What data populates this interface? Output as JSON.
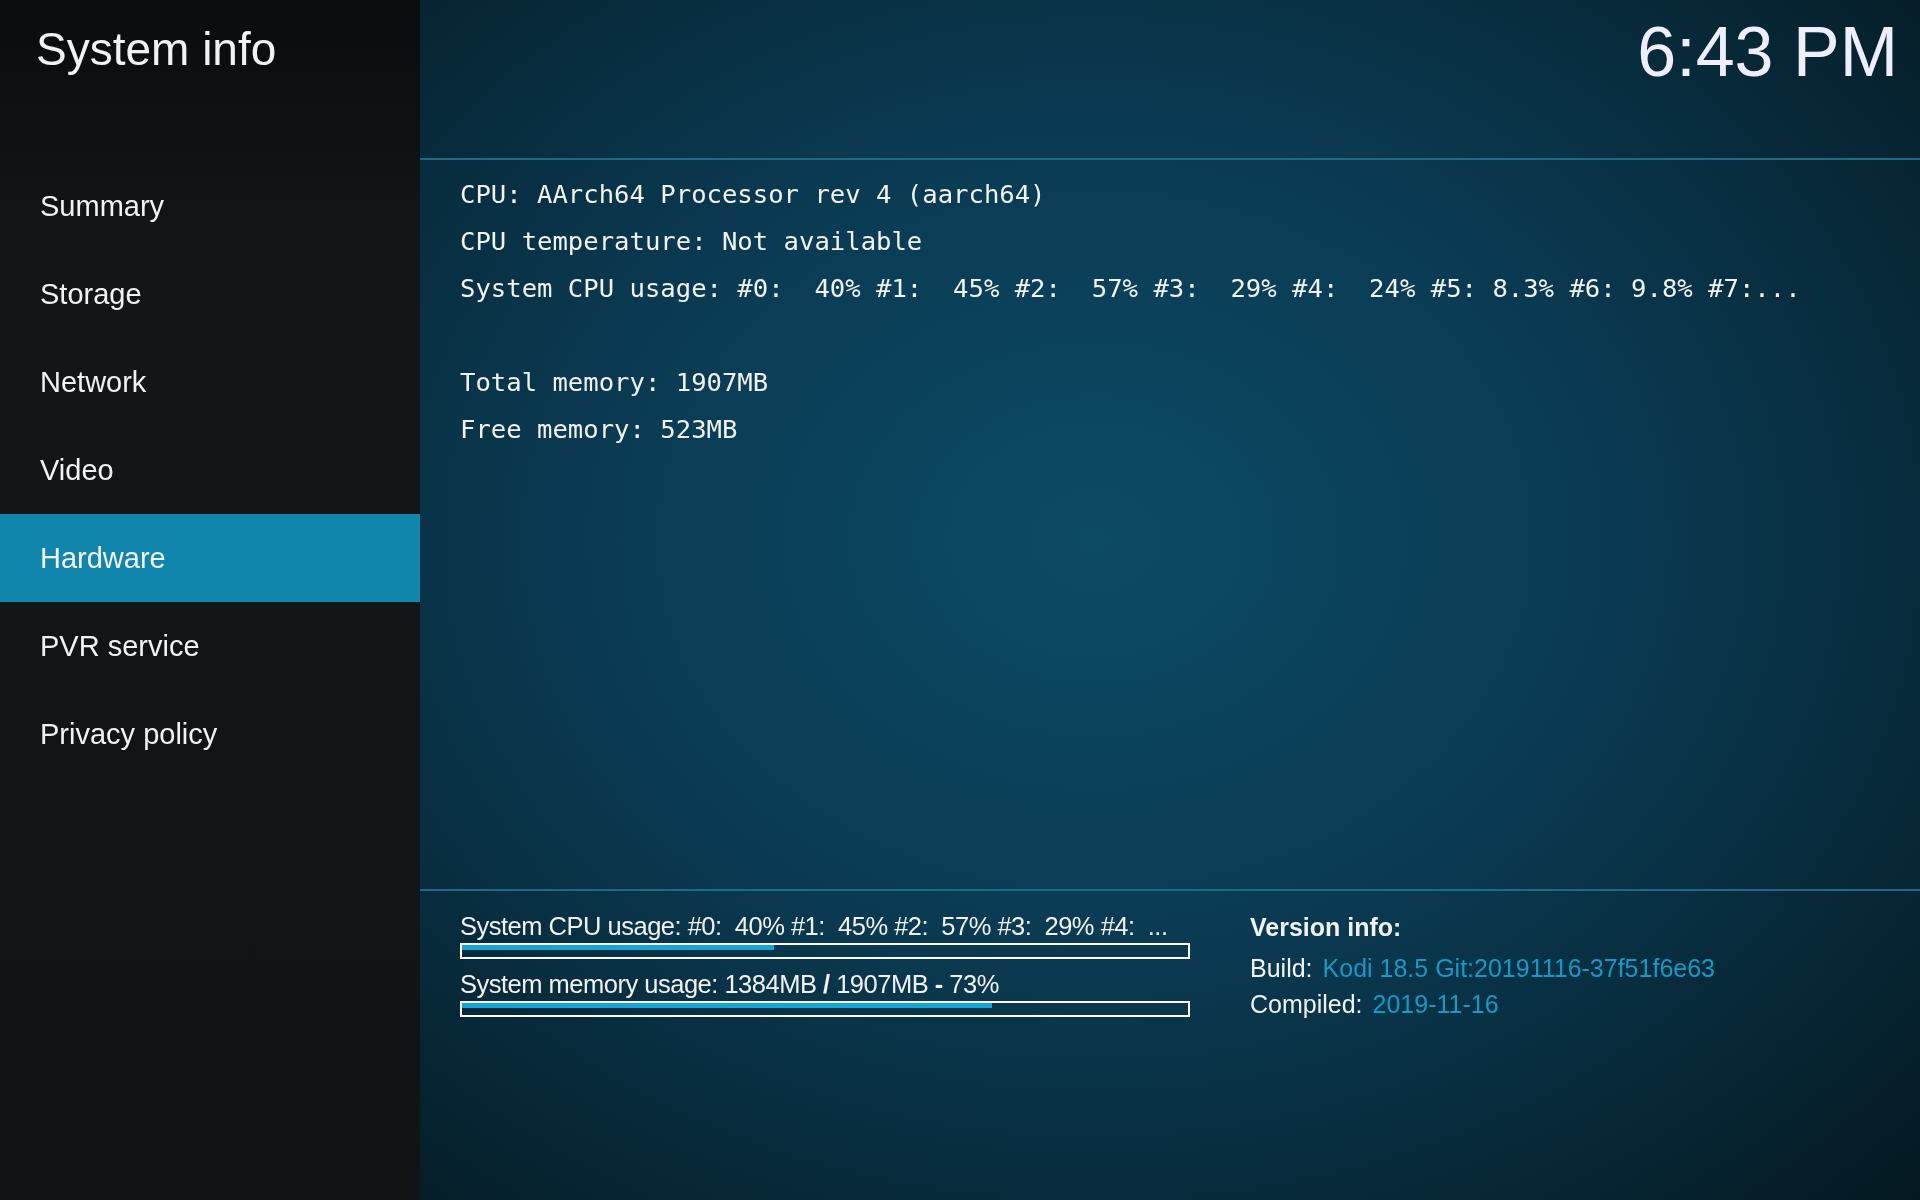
{
  "window": {
    "title": "System info"
  },
  "clock": "6:43 PM",
  "sidebar": {
    "items": [
      {
        "label": "Summary",
        "selected": false
      },
      {
        "label": "Storage",
        "selected": false
      },
      {
        "label": "Network",
        "selected": false
      },
      {
        "label": "Video",
        "selected": false
      },
      {
        "label": "Hardware",
        "selected": true
      },
      {
        "label": "PVR service",
        "selected": false
      },
      {
        "label": "Privacy policy",
        "selected": false
      }
    ]
  },
  "details": [
    [
      "CPU: AArch64 Processor rev 4 (aarch64)",
      "CPU temperature: Not available",
      "System CPU usage: #0:  40% #1:  45% #2:  57% #3:  29% #4:  24% #5: 8.3% #6: 9.8% #7:..."
    ],
    [
      "Total memory: 1907MB",
      "Free memory: 523MB"
    ]
  ],
  "meters": [
    {
      "label": "System CPU usage: #0:  40% #1:  45% #2:  57% #3:  29% #4:  ...",
      "level": 0.43
    },
    {
      "label": "System memory usage: 1384MB **/** 1907MB **-** 73%",
      "level": 0.73
    }
  ],
  "version_info": {
    "heading": "Version info:",
    "rows": [
      {
        "label": "Build:",
        "value": "Kodi 18.5 Git:20191116-37f51f6e63"
      },
      {
        "label": "Compiled:",
        "value": "2019-11-16"
      }
    ]
  }
}
